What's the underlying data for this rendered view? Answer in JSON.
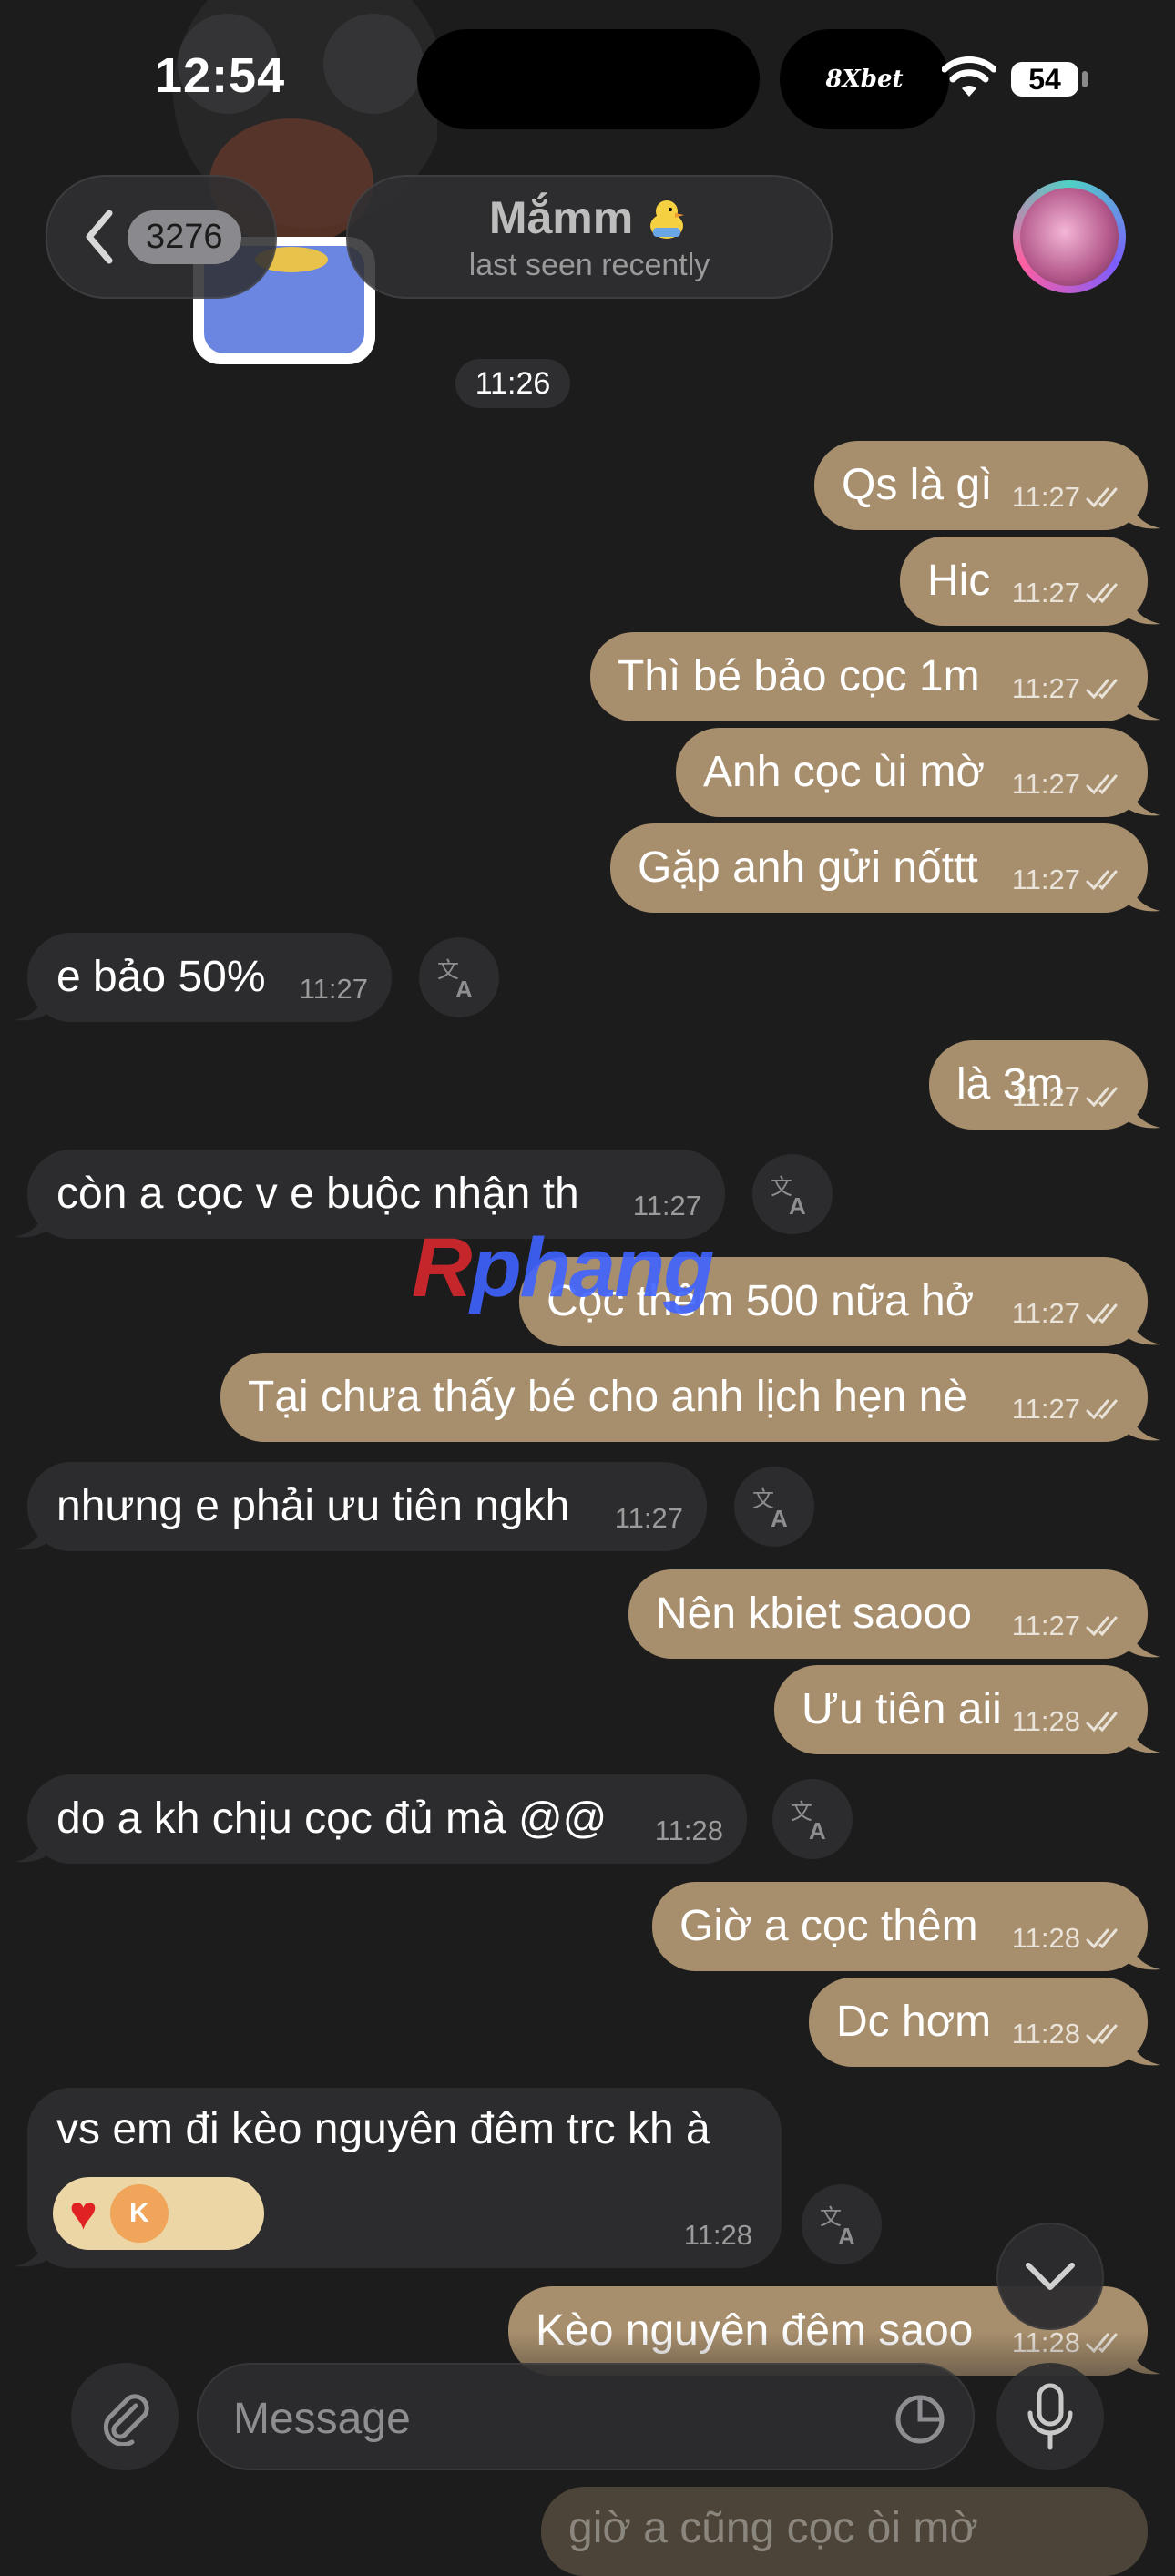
{
  "status_bar": {
    "time": "12:54",
    "ad_label": "8Xbet",
    "battery": "54"
  },
  "header": {
    "back_count": "3276",
    "title": "Mắmm",
    "subtitle": "last seen recently"
  },
  "date_pill": "11:26",
  "messages": [
    {
      "dir": "out",
      "text": "Qs là gì",
      "time": "11:27"
    },
    {
      "dir": "out",
      "text": "Hic",
      "time": "11:27"
    },
    {
      "dir": "out",
      "text": "Thì bé bảo cọc 1m",
      "time": "11:27"
    },
    {
      "dir": "out",
      "text": "Anh cọc ùi mờ",
      "time": "11:27"
    },
    {
      "dir": "out",
      "text": "Gặp anh gửi nốttt",
      "time": "11:27"
    },
    {
      "dir": "in",
      "text": "e bảo 50%",
      "time": "11:27"
    },
    {
      "dir": "out",
      "text": "là 3m",
      "time": "11:27"
    },
    {
      "dir": "in",
      "text": "còn a cọc v e buộc nhận th",
      "time": "11:27"
    },
    {
      "dir": "out",
      "text": "Cọc thêm 500 nữa hở",
      "time": "11:27"
    },
    {
      "dir": "out",
      "text": "Tại chưa thấy bé cho anh lịch hẹn nè",
      "time": "11:27"
    },
    {
      "dir": "in",
      "text": "nhưng e phải ưu tiên ngkh",
      "time": "11:27"
    },
    {
      "dir": "out",
      "text": "Nên kbiet saooo",
      "time": "11:27"
    },
    {
      "dir": "out",
      "text": "Ưu tiên aii",
      "time": "11:28"
    },
    {
      "dir": "in",
      "text": "do a kh chịu cọc đủ mà @@",
      "time": "11:28"
    },
    {
      "dir": "out",
      "text": "Giờ a cọc thêm",
      "time": "11:28"
    },
    {
      "dir": "out",
      "text": "Dc hơm",
      "time": "11:28"
    },
    {
      "dir": "in",
      "text": "vs em đi kèo nguyên đêm trc kh à",
      "time": "11:28",
      "reactions": [
        "❤️",
        "K"
      ]
    },
    {
      "dir": "out",
      "text": "Kèo nguyên đêm saoo",
      "time": "11:28"
    },
    {
      "dir": "out",
      "text": "giờ a cũng cọc òi mờ",
      "time": ""
    }
  ],
  "watermark": {
    "r": "R",
    "rest": "phang"
  },
  "composer": {
    "placeholder": "Message"
  },
  "icons": [
    "chevron-left-icon",
    "translate-icon",
    "double-check-icon",
    "paperclip-icon",
    "sticker-icon",
    "microphone-icon",
    "chevron-down-icon",
    "wifi-icon"
  ],
  "colors": {
    "outgoing_bubble": "#a78e6c",
    "incoming_bubble": "#2c2c2e",
    "background": "#1c1c1d"
  }
}
